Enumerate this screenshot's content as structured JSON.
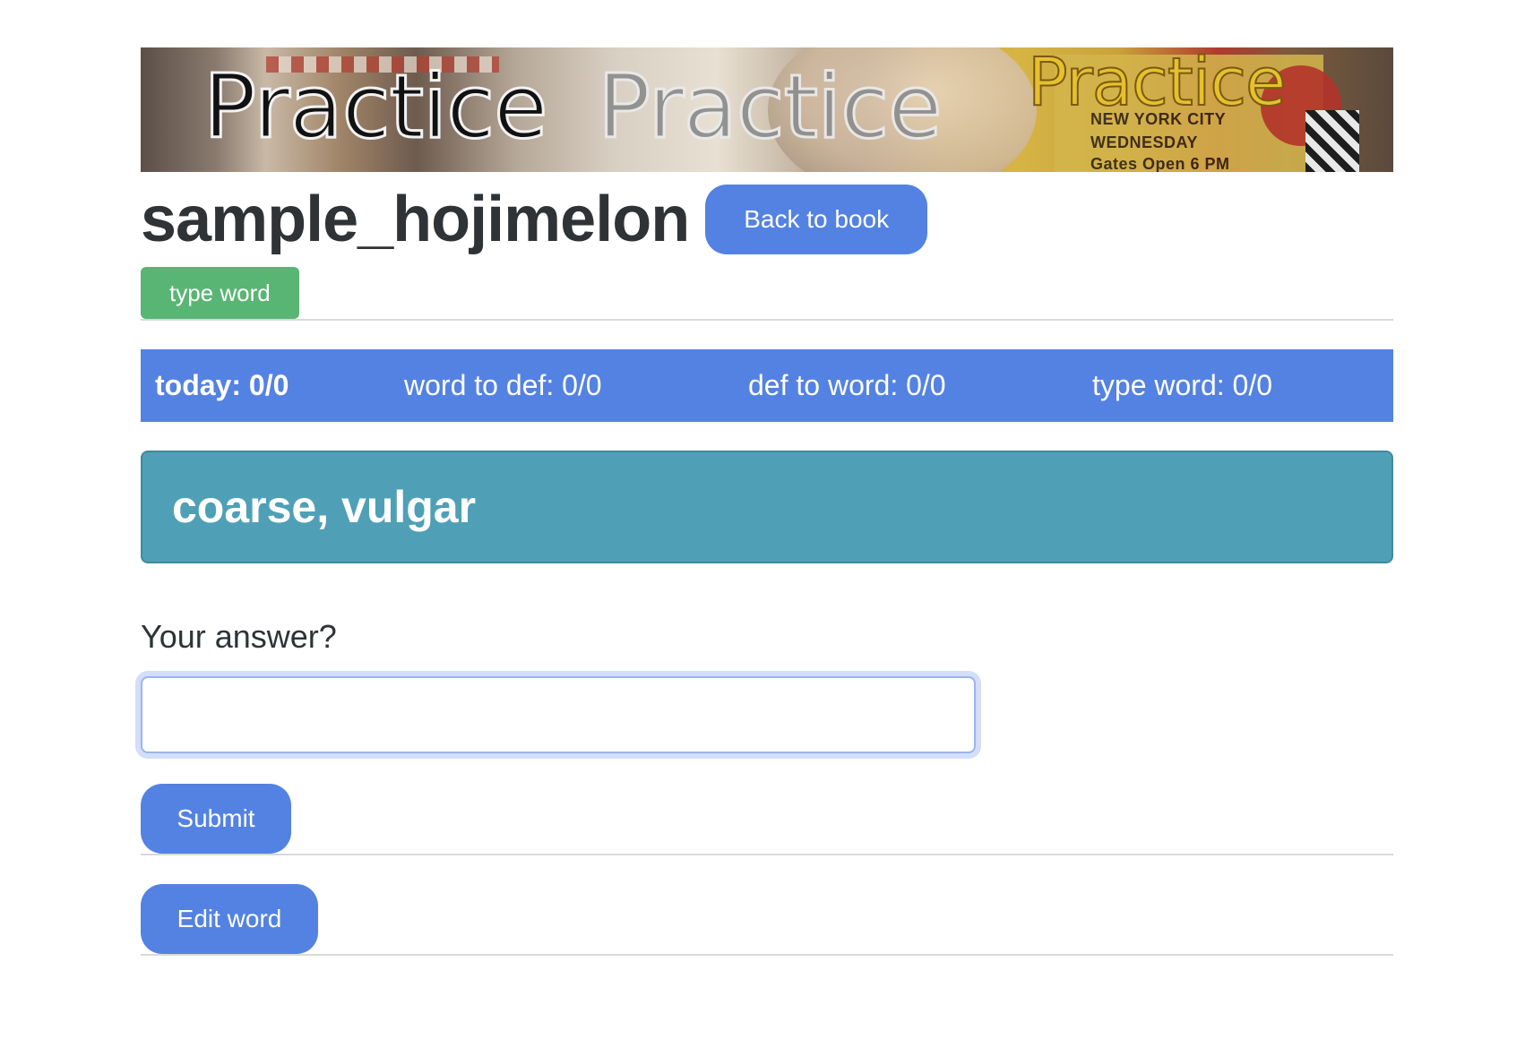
{
  "banner": {
    "words": [
      "Practice",
      "Practice",
      "Practice"
    ],
    "poster_text": [
      "NEW YORK CITY",
      "WEDNESDAY",
      "Gates Open 6 PM"
    ]
  },
  "header": {
    "title": "sample_hojimelon",
    "back_button_label": "Back to book",
    "mode_badge": "type word"
  },
  "stats": {
    "today": "today: 0/0",
    "word_to_def": "word to def: 0/0",
    "def_to_word": "def to word: 0/0",
    "type_word": "type word: 0/0"
  },
  "prompt": {
    "definition": "coarse, vulgar"
  },
  "answer": {
    "label": "Your answer?",
    "value": "",
    "submit_label": "Submit"
  },
  "actions": {
    "edit_label": "Edit word"
  },
  "colors": {
    "primary": "#5482e2",
    "success": "#59b574",
    "info": "#4fa0b6",
    "text": "#2f3336"
  }
}
